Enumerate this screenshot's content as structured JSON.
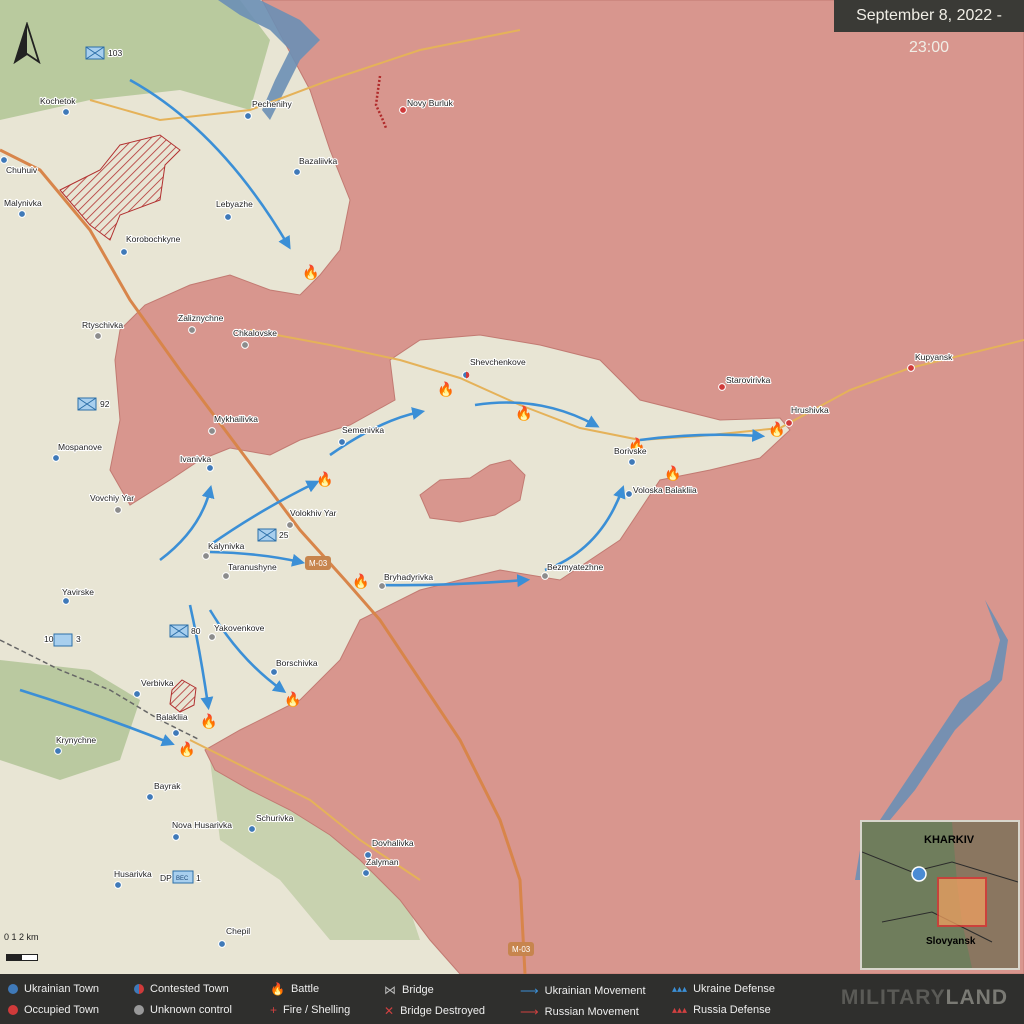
{
  "header": {
    "date_time": "September 8, 2022 - 23:00"
  },
  "towns": [
    {
      "name": "Kochetok",
      "status": "ukrainian"
    },
    {
      "name": "Pechenihy",
      "status": "ukrainian"
    },
    {
      "name": "Novy Burluk",
      "status": "occupied"
    },
    {
      "name": "Chuhuiv",
      "status": "ukrainian"
    },
    {
      "name": "Bazaliivka",
      "status": "ukrainian"
    },
    {
      "name": "Malynivka",
      "status": "ukrainian"
    },
    {
      "name": "Lebyazhe",
      "status": "ukrainian"
    },
    {
      "name": "Korobochkyne",
      "status": "ukrainian"
    },
    {
      "name": "Rtyschivka",
      "status": "unknown"
    },
    {
      "name": "Zaliznychne",
      "status": "unknown"
    },
    {
      "name": "Chkalovske",
      "status": "unknown"
    },
    {
      "name": "Shevchenkove",
      "status": "contested"
    },
    {
      "name": "Kupyansk",
      "status": "occupied"
    },
    {
      "name": "Starovirivka",
      "status": "occupied"
    },
    {
      "name": "Hrushivka",
      "status": "occupied"
    },
    {
      "name": "Mykhailivka",
      "status": "unknown"
    },
    {
      "name": "Semenivka",
      "status": "ukrainian"
    },
    {
      "name": "Mospanove",
      "status": "ukrainian"
    },
    {
      "name": "Ivanivka",
      "status": "ukrainian"
    },
    {
      "name": "Borivske",
      "status": "ukrainian"
    },
    {
      "name": "Voloska Balakliia",
      "status": "ukrainian"
    },
    {
      "name": "Vovchiy Yar",
      "status": "unknown"
    },
    {
      "name": "Volokhiv Yar",
      "status": "unknown"
    },
    {
      "name": "Kalynivka",
      "status": "unknown"
    },
    {
      "name": "Taranushyne",
      "status": "unknown"
    },
    {
      "name": "Bryhadyrivka",
      "status": "unknown"
    },
    {
      "name": "Bezmyatezhne",
      "status": "unknown"
    },
    {
      "name": "Yavirske",
      "status": "ukrainian"
    },
    {
      "name": "Yakovenkove",
      "status": "unknown"
    },
    {
      "name": "Borschivka",
      "status": "ukrainian"
    },
    {
      "name": "Verbivka",
      "status": "ukrainian"
    },
    {
      "name": "Balakliia",
      "status": "ukrainian"
    },
    {
      "name": "Krynychne",
      "status": "ukrainian"
    },
    {
      "name": "Bayrak",
      "status": "ukrainian"
    },
    {
      "name": "Schurivka",
      "status": "ukrainian"
    },
    {
      "name": "Nova Husarivka",
      "status": "ukrainian"
    },
    {
      "name": "Dovhalivka",
      "status": "ukrainian"
    },
    {
      "name": "Zalyman",
      "status": "ukrainian"
    },
    {
      "name": "Husarivka",
      "status": "ukrainian"
    },
    {
      "name": "Chepil",
      "status": "ukrainian"
    }
  ],
  "roads": {
    "m03_top": "M-03",
    "m03_bottom": "M-03"
  },
  "units": {
    "u1": "103",
    "u2": "92",
    "u3": "25",
    "u4": "80",
    "u5a": "10",
    "u5b": "3",
    "u6a": "DP",
    "u6b": "ВЕС",
    "u6c": "1"
  },
  "scale": {
    "label": "0  1  2 km"
  },
  "inset": {
    "city_top": "KHARKIV",
    "city_bottom": "Slovyansk"
  },
  "legend": {
    "ukrainian_town": "Ukrainian Town",
    "occupied_town": "Occupied Town",
    "contested_town": "Contested Town",
    "unknown_control": "Unknown control",
    "battle": "Battle",
    "fire_shelling": "Fire / Shelling",
    "bridge": "Bridge",
    "bridge_destroyed": "Bridge Destroyed",
    "ukrainian_movement": "Ukrainian Movement",
    "russian_movement": "Russian Movement",
    "ukraine_defense": "Ukraine Defense",
    "russia_defense": "Russia Defense",
    "brand_a": "MILITARY",
    "brand_b": "LAND"
  },
  "colors": {
    "occupied": "#d8928a",
    "ukrainian": "#3f79b8",
    "contested": "#c0392b",
    "unknown": "#8c8c8c",
    "movement_ua": "#3b8fd6",
    "movement_ru": "#d04040",
    "water": "#6b8fb5",
    "road_major": "#d8854a"
  }
}
